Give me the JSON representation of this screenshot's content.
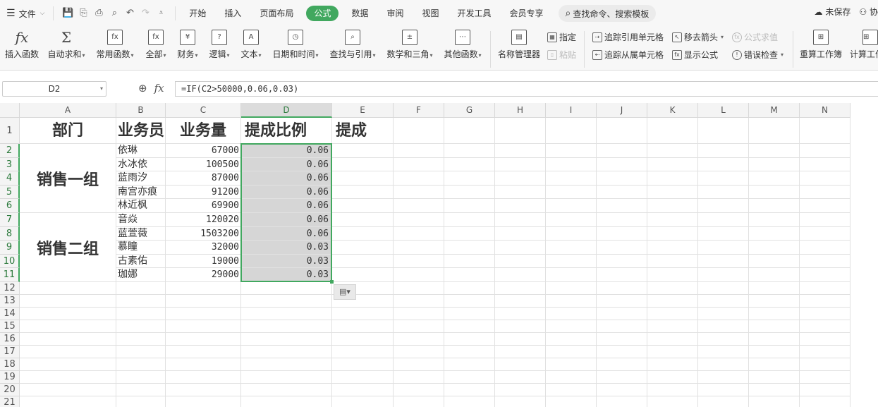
{
  "menubar": {
    "file_label": "文件",
    "tabs": [
      "开始",
      "插入",
      "页面布局",
      "公式",
      "数据",
      "审阅",
      "视图",
      "开发工具",
      "会员专享"
    ],
    "active_tab": "公式",
    "search_placeholder": "查找命令、搜索模板",
    "unsaved_label": "未保存",
    "collab_label": "协"
  },
  "ribbon": {
    "insert_function": "插入函数",
    "autosum": "自动求和",
    "common_functions": "常用函数",
    "all": "全部",
    "financial": "财务",
    "logical": "逻辑",
    "text": "文本",
    "datetime": "日期和时间",
    "lookup": "查找与引用",
    "math": "数学和三角",
    "other": "其他函数",
    "name_manager": "名称管理器",
    "define": "指定",
    "paste": "粘贴",
    "trace_precedents": "追踪引用单元格",
    "trace_dependents": "追踪从属单元格",
    "remove_arrows": "移去箭头",
    "show_formulas": "显示公式",
    "evaluate": "公式求值",
    "error_check": "错误检查",
    "recalc_workbook": "重算工作簿",
    "calc_worksheet": "计算工作表"
  },
  "formula_bar": {
    "cell_ref": "D2",
    "formula": "=IF(C2>50000,0.06,0.03)"
  },
  "sheet": {
    "columns": [
      "A",
      "B",
      "C",
      "D",
      "E",
      "F",
      "G",
      "H",
      "I",
      "J",
      "K",
      "L",
      "M",
      "N"
    ],
    "rows": [
      "1",
      "2",
      "3",
      "4",
      "5",
      "6",
      "7",
      "8",
      "9",
      "10",
      "11",
      "12",
      "13",
      "14",
      "15",
      "16",
      "17",
      "18",
      "19",
      "20",
      "21"
    ],
    "headers": [
      "部门",
      "业务员",
      "业务量",
      "提成比例",
      "提成"
    ],
    "groups": [
      "销售一组",
      "销售二组"
    ],
    "data": [
      {
        "name": "依琳",
        "volume": "67000",
        "rate": "0.06"
      },
      {
        "name": "水冰依",
        "volume": "100500",
        "rate": "0.06"
      },
      {
        "name": "蓝雨汐",
        "volume": "87000",
        "rate": "0.06"
      },
      {
        "name": "南宫亦痕",
        "volume": "91200",
        "rate": "0.06"
      },
      {
        "name": "林近枫",
        "volume": "69900",
        "rate": "0.06"
      },
      {
        "name": "音焱",
        "volume": "120020",
        "rate": "0.06"
      },
      {
        "name": "蓝萱薇",
        "volume": "1503200",
        "rate": "0.06"
      },
      {
        "name": "慕瞳",
        "volume": "32000",
        "rate": "0.03"
      },
      {
        "name": "古素佑",
        "volume": "19000",
        "rate": "0.03"
      },
      {
        "name": "珈娜",
        "volume": "29000",
        "rate": "0.03"
      }
    ]
  },
  "colors": {
    "accent": "#41a85f",
    "selection_fill": "#d6d6d6"
  }
}
